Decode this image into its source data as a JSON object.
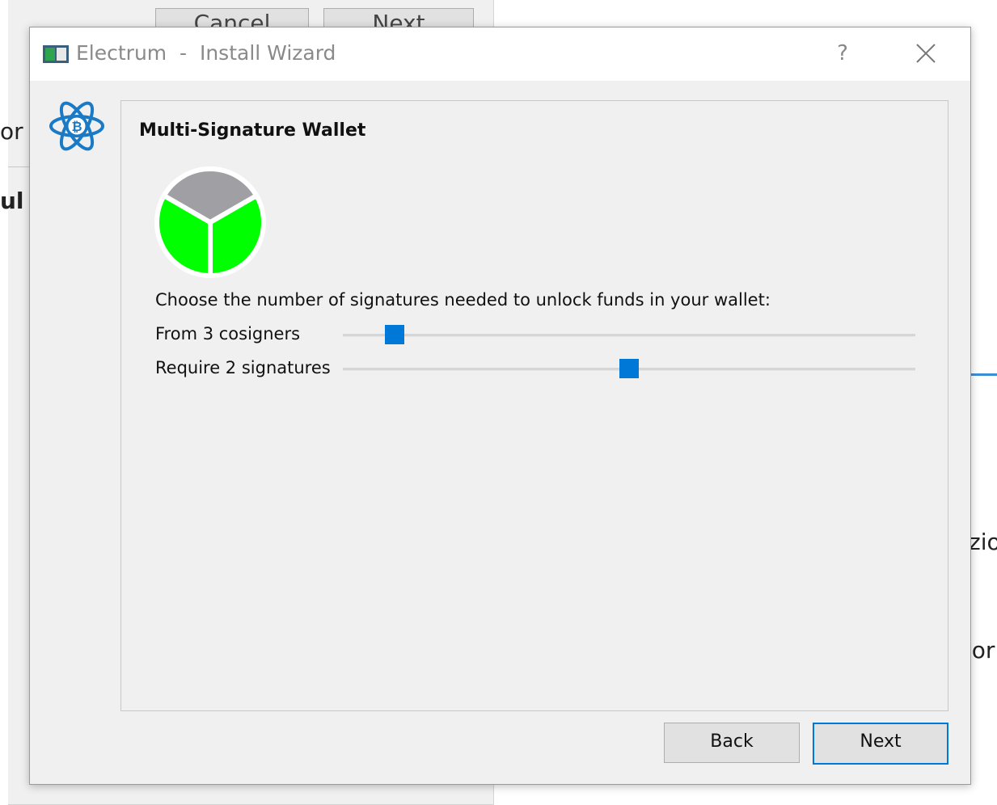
{
  "background": {
    "cancel_label": "Cancel",
    "next_label": "Next",
    "fragment_1": "or",
    "fragment_2": "ul",
    "fragment_3": "zio",
    "fragment_4": "ior"
  },
  "dialog": {
    "title": "Electrum  -  Install Wizard",
    "help_label": "?",
    "page_title": "Multi-Signature Wallet",
    "instructions": "Choose the number of signatures needed to unlock funds in your wallet:",
    "cosigners": {
      "label": "From 3 cosigners",
      "value": 3,
      "level": 0.09
    },
    "signatures": {
      "label": "Require 2 signatures",
      "value": 2,
      "level": 0.5
    },
    "pie": {
      "total": 3,
      "required": 2,
      "colors": {
        "required": "#00ff00",
        "other": "#a0a0a4",
        "separator": "#ffffff"
      }
    },
    "back_label": "Back",
    "next_label": "Next"
  },
  "colors": {
    "accent": "#0078d7",
    "logo": "#1a7ac6"
  }
}
